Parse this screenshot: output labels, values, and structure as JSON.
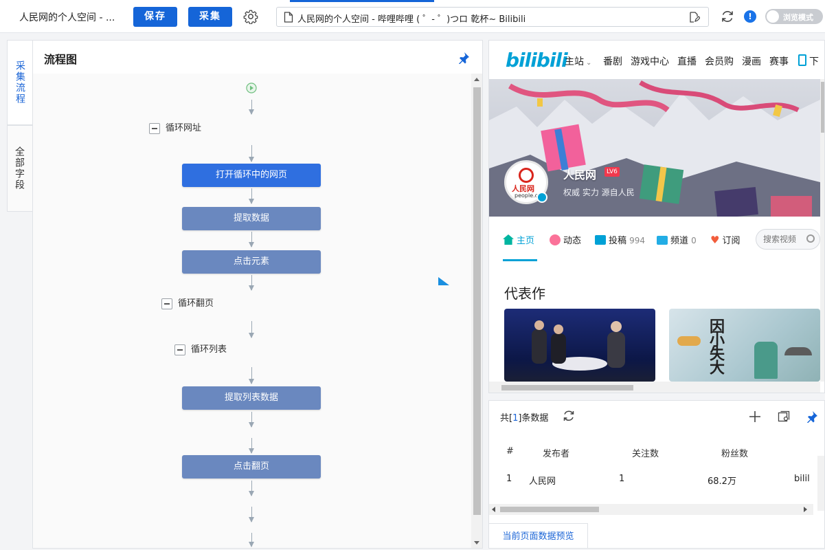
{
  "topbar": {
    "task_name": "人民网的个人空间 - ...",
    "save_label": "保存",
    "collect_label": "采集",
    "url": "人民网的个人空间 - 哔哩哔哩 ( ゜- ゜)つロ 乾杯~ Bilibili",
    "browse_mode_label": "浏览模式",
    "info_badge": "!"
  },
  "sidebar": {
    "tabs": [
      {
        "label": "采集流程"
      },
      {
        "label": "全部字段"
      }
    ]
  },
  "flow": {
    "title": "流程图",
    "loops": [
      "循环网址",
      "循环翻页",
      "循环列表"
    ],
    "nodes": [
      "打开循环中的网页",
      "提取数据",
      "点击元素",
      "提取列表数据",
      "点击翻页"
    ]
  },
  "browser": {
    "logo": "bilibili",
    "nav": [
      "主站",
      "番剧",
      "游戏中心",
      "直播",
      "会员购",
      "漫画",
      "赛事",
      "下"
    ],
    "user": {
      "name": "人民网",
      "level": "LV6",
      "sign": "权威 实力 源自人民",
      "avatar_text": "人民网",
      "avatar_sub": "people.c"
    },
    "tabs": [
      {
        "label": "主页",
        "count": ""
      },
      {
        "label": "动态",
        "count": ""
      },
      {
        "label": "投稿",
        "count": "994"
      },
      {
        "label": "频道",
        "count": "0"
      },
      {
        "label": "订阅",
        "count": ""
      }
    ],
    "search_placeholder": "搜索视频",
    "section_title": "代表作",
    "thumb_text": "因小失大"
  },
  "data": {
    "summary_prefix": "共[",
    "count": "1",
    "summary_suffix": "]条数据",
    "columns": [
      "#",
      "发布者",
      "关注数",
      "粉丝数"
    ],
    "rows": [
      {
        "idx": "1",
        "publisher": "人民网",
        "following": "1",
        "fans": "68.2万",
        "extra": "bilil"
      }
    ],
    "footer_tab": "当前页面数据预览"
  },
  "colors": {
    "primary": "#1565d8",
    "node_active": "#2f6fe0",
    "node_normal": "#6a88bf",
    "bili_blue": "#00a1d6",
    "bili_pink": "#fb7299"
  }
}
